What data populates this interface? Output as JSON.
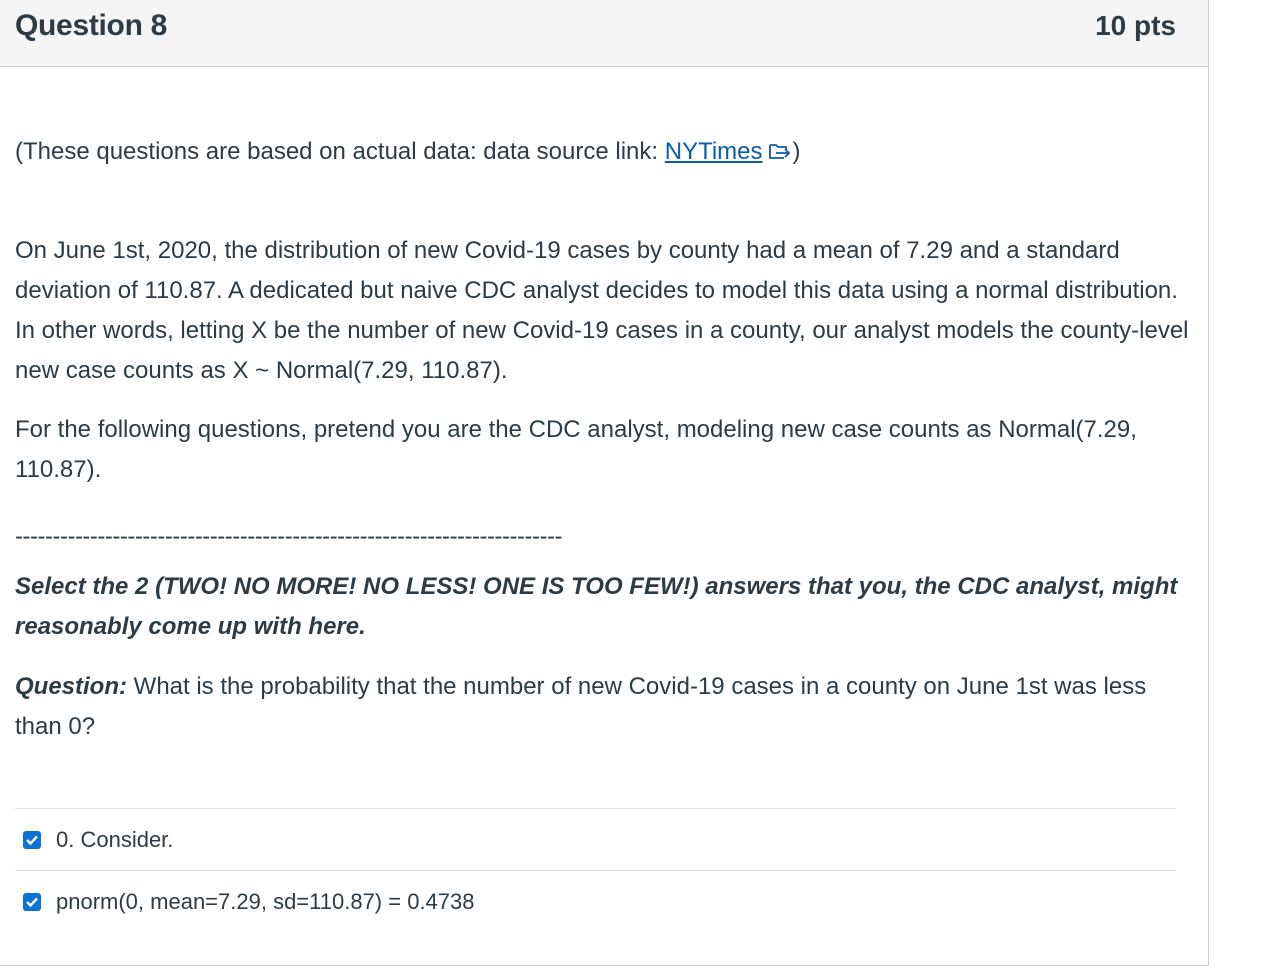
{
  "header": {
    "title": "Question 8",
    "points": "10 pts"
  },
  "source": {
    "prefix": "(These questions are based on actual data: data source link: ",
    "link_text": "NYTimes",
    "suffix": ")"
  },
  "intro": "On June 1st, 2020, the distribution of new Covid-19 cases by county had a mean of 7.29 and a standard deviation of 110.87.   A dedicated but naive CDC analyst decides to model this data using a normal distribution.  In other words, letting X be the number of new Covid-19 cases in a county, our analyst models the county-level new case counts as  X ~ Normal(7.29, 110.87).",
  "follow_up": "For the following questions, pretend you are the CDC analyst, modeling new case counts as Normal(7.29, 110.87).",
  "separator": "-------------------------------------------------------------------------",
  "instruction": "Select the 2 (TWO! NO MORE!  NO LESS!  ONE IS TOO FEW!) answers that you, the CDC analyst, might reasonably come up with here.",
  "question": {
    "label": "Question:",
    "text": " What is the probability that the number of new Covid-19 cases in a county on June 1st was less than 0?"
  },
  "answers": [
    {
      "text": "0. Consider.",
      "checked": true
    },
    {
      "text": "pnorm(0, mean=7.29, sd=110.87) = 0.4738",
      "checked": true
    }
  ],
  "colors": {
    "link": "#0b5cab",
    "checkbox": "#0b73d6",
    "text": "#2d3b45",
    "header_bg": "#f5f5f5"
  }
}
